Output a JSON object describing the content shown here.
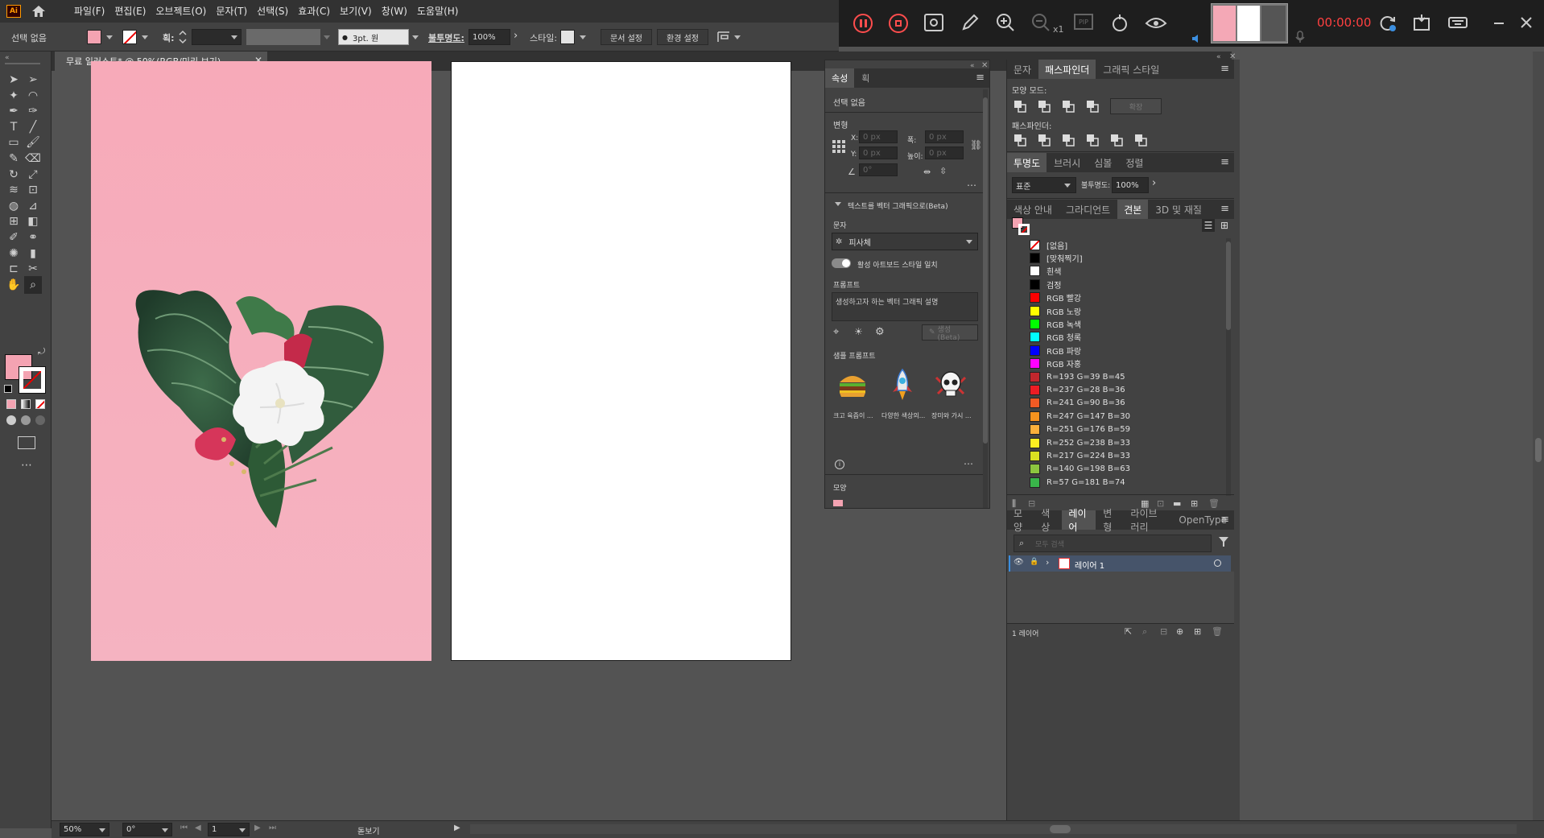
{
  "app": {
    "logo": "Ai"
  },
  "menu": [
    "파일(F)",
    "편집(E)",
    "오브젝트(O)",
    "문자(T)",
    "선택(S)",
    "효과(C)",
    "보기(V)",
    "창(W)",
    "도움말(H)"
  ],
  "recorder": {
    "timer": "00:00:00",
    "zoom_suffix": "x1",
    "pip": "PIP"
  },
  "control": {
    "selection": "선택 없음",
    "stroke_label": "획:",
    "brush": "3pt. 원",
    "opacity_label": "불투명도:",
    "opacity": "100%",
    "style_label": "스타일:",
    "doc_setup": "문서 설정",
    "prefs": "환경 설정"
  },
  "doc_tab": {
    "title": "무료 일러스트* @ 50%(RGB/미리 보기)"
  },
  "props": {
    "tabs": [
      "속성",
      "획"
    ],
    "selection": "선택 없음",
    "transform": "변형",
    "x_label": "X:",
    "y_label": "Y:",
    "w_label": "폭:",
    "h_label": "높이:",
    "x": "0 px",
    "y": "0 px",
    "w": "0 px",
    "h": "0 px",
    "angle": "0°",
    "text_to_vector": "텍스트를 벡터 그래픽으로(Beta)",
    "subject_label": "문자",
    "subject": "피사체",
    "match_style": "활성 아트보드 스타일 일치",
    "prompt_label": "프롬프트",
    "prompt_placeholder": "생성하고자 하는 벡터 그래픽 설명",
    "generate": "생성(Beta)",
    "samples_label": "샘플 프롬프트",
    "samples": [
      "크고 육즙이 ...",
      "다양한 색상의...",
      "장미와 가시 ..."
    ],
    "appearance": "모양"
  },
  "pathfinder": {
    "tabs": [
      "문자",
      "패스파인더",
      "그래픽 스타일"
    ],
    "shape_modes": "모양 모드:",
    "expand": "확장",
    "pathfinders": "패스파인더:"
  },
  "transparency": {
    "tabs": [
      "투명도",
      "브러시",
      "심볼",
      "정렬"
    ],
    "mode": "표준",
    "opacity_label": "불투명도:",
    "opacity": "100%"
  },
  "swatches": {
    "tabs": [
      "색상 안내",
      "그라디언트",
      "견본",
      "3D 및 재질"
    ],
    "items": [
      {
        "name": "[없음]",
        "color": "none"
      },
      {
        "name": "[맞춰찍기]",
        "color": "#000000"
      },
      {
        "name": "흰색",
        "color": "#ffffff"
      },
      {
        "name": "검정",
        "color": "#000000"
      },
      {
        "name": "RGB 빨강",
        "color": "#ff0000"
      },
      {
        "name": "RGB 노랑",
        "color": "#ffff00"
      },
      {
        "name": "RGB 녹색",
        "color": "#00ff00"
      },
      {
        "name": "RGB 청록",
        "color": "#00ffff"
      },
      {
        "name": "RGB 파랑",
        "color": "#0000ff"
      },
      {
        "name": "RGB 자홍",
        "color": "#ff00ff"
      },
      {
        "name": "R=193 G=39 B=45",
        "color": "#c1272d"
      },
      {
        "name": "R=237 G=28 B=36",
        "color": "#ed1c24"
      },
      {
        "name": "R=241 G=90 B=36",
        "color": "#f15a24"
      },
      {
        "name": "R=247 G=147 B=30",
        "color": "#f7931e"
      },
      {
        "name": "R=251 G=176 B=59",
        "color": "#fbb03b"
      },
      {
        "name": "R=252 G=238 B=33",
        "color": "#fcee21"
      },
      {
        "name": "R=217 G=224 B=33",
        "color": "#d9e021"
      },
      {
        "name": "R=140 G=198 B=63",
        "color": "#8cc63f"
      },
      {
        "name": "R=57 G=181 B=74",
        "color": "#39b54a"
      }
    ]
  },
  "layers": {
    "tabs": [
      "모양",
      "색상",
      "레이어",
      "변형",
      "라이브러리",
      "OpenType"
    ],
    "search_placeholder": "모두 검색",
    "layer_name": "레이어 1",
    "count": "1 레이어"
  },
  "status": {
    "zoom": "50%",
    "rotate": "0°",
    "page": "1",
    "mode": "돋보기"
  },
  "colors": {
    "fill": "#f4a3b2",
    "artboard_bg": "#f7b4c1",
    "accent": "#ff4040"
  }
}
